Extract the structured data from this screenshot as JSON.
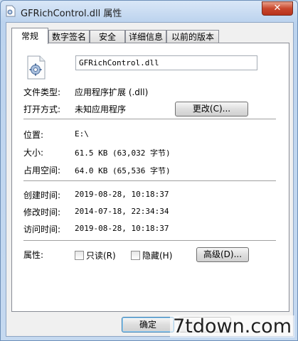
{
  "window": {
    "title": "GFRichControl.dll 属性",
    "close_label": "✕"
  },
  "tabs": [
    {
      "label": "常规",
      "active": true
    },
    {
      "label": "数字签名",
      "active": false
    },
    {
      "label": "安全",
      "active": false
    },
    {
      "label": "详细信息",
      "active": false
    },
    {
      "label": "以前的版本",
      "active": false
    }
  ],
  "general": {
    "file_name": "GFRichControl.dll",
    "file_type_label": "文件类型:",
    "file_type_value": "应用程序扩展 (.dll)",
    "open_with_label": "打开方式:",
    "open_with_value": "未知应用程序",
    "change_button": "更改(C)...",
    "location_label": "位置:",
    "location_value": "E:\\",
    "size_label": "大小:",
    "size_value": "61.5 KB (63,032 字节)",
    "size_on_disk_label": "占用空间:",
    "size_on_disk_value": "64.0 KB (65,536 字节)",
    "created_label": "创建时间:",
    "created_value": "2019-08-28, 10:18:37",
    "modified_label": "修改时间:",
    "modified_value": "2014-07-18, 22:34:34",
    "accessed_label": "访问时间:",
    "accessed_value": "2019-08-28, 10:18:37",
    "attributes_label": "属性:",
    "readonly_label": "只读(R)",
    "readonly_checked": false,
    "hidden_label": "隐藏(H)",
    "hidden_checked": false,
    "advanced_button": "高级(D)..."
  },
  "footer": {
    "ok_button": "确定",
    "cancel_button": ""
  },
  "watermark": "7tdown.com",
  "colors": {
    "title_bar": "#c9dcf1",
    "close_button": "#c9472d",
    "panel_background": "#ffffff"
  },
  "icons": {
    "title": "dll-file-icon",
    "file": "gear-document-icon"
  }
}
